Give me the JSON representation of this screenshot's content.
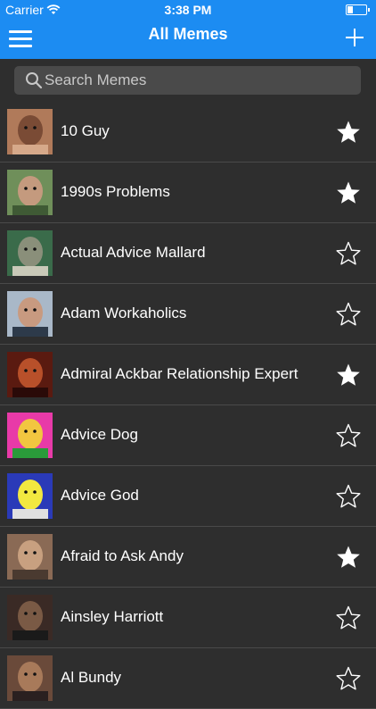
{
  "status": {
    "carrier": "Carrier",
    "time": "3:38 PM",
    "battery_level": 0.35
  },
  "nav": {
    "title": "All Memes"
  },
  "search": {
    "placeholder": "Search Memes"
  },
  "colors": {
    "bar": "#1c8cf2",
    "background": "#2e2e2e",
    "field": "#4a4a4a"
  },
  "memes": [
    {
      "name": "10 Guy",
      "favorite": true,
      "thumb": [
        "#b07a5a",
        "#7a4b35",
        "#d6a98a"
      ]
    },
    {
      "name": "1990s Problems",
      "favorite": true,
      "thumb": [
        "#6f8f5a",
        "#c49a7e",
        "#3f5a35"
      ]
    },
    {
      "name": "Actual Advice Mallard",
      "favorite": false,
      "thumb": [
        "#3a6b4a",
        "#8a8f7a",
        "#c9c9b8"
      ]
    },
    {
      "name": "Adam Workaholics",
      "favorite": false,
      "thumb": [
        "#a9b8c8",
        "#c89a80",
        "#2d3a4a"
      ]
    },
    {
      "name": "Admiral Ackbar Relationship Expert",
      "favorite": true,
      "thumb": [
        "#5a1a10",
        "#b8502a",
        "#2a0a08"
      ]
    },
    {
      "name": "Advice Dog",
      "favorite": false,
      "thumb": [
        "#e83aa8",
        "#f2c640",
        "#2a9a3a"
      ]
    },
    {
      "name": "Advice God",
      "favorite": false,
      "thumb": [
        "#2a3ab8",
        "#f2e840",
        "#e0e0e0"
      ]
    },
    {
      "name": "Afraid to Ask Andy",
      "favorite": true,
      "thumb": [
        "#8a6a55",
        "#c8a080",
        "#4a3a30"
      ]
    },
    {
      "name": "Ainsley Harriott",
      "favorite": false,
      "thumb": [
        "#3a2a25",
        "#7a5a45",
        "#1a1a1a"
      ]
    },
    {
      "name": "Al Bundy",
      "favorite": false,
      "thumb": [
        "#6a4a3a",
        "#a87a5a",
        "#2a2020"
      ]
    }
  ]
}
